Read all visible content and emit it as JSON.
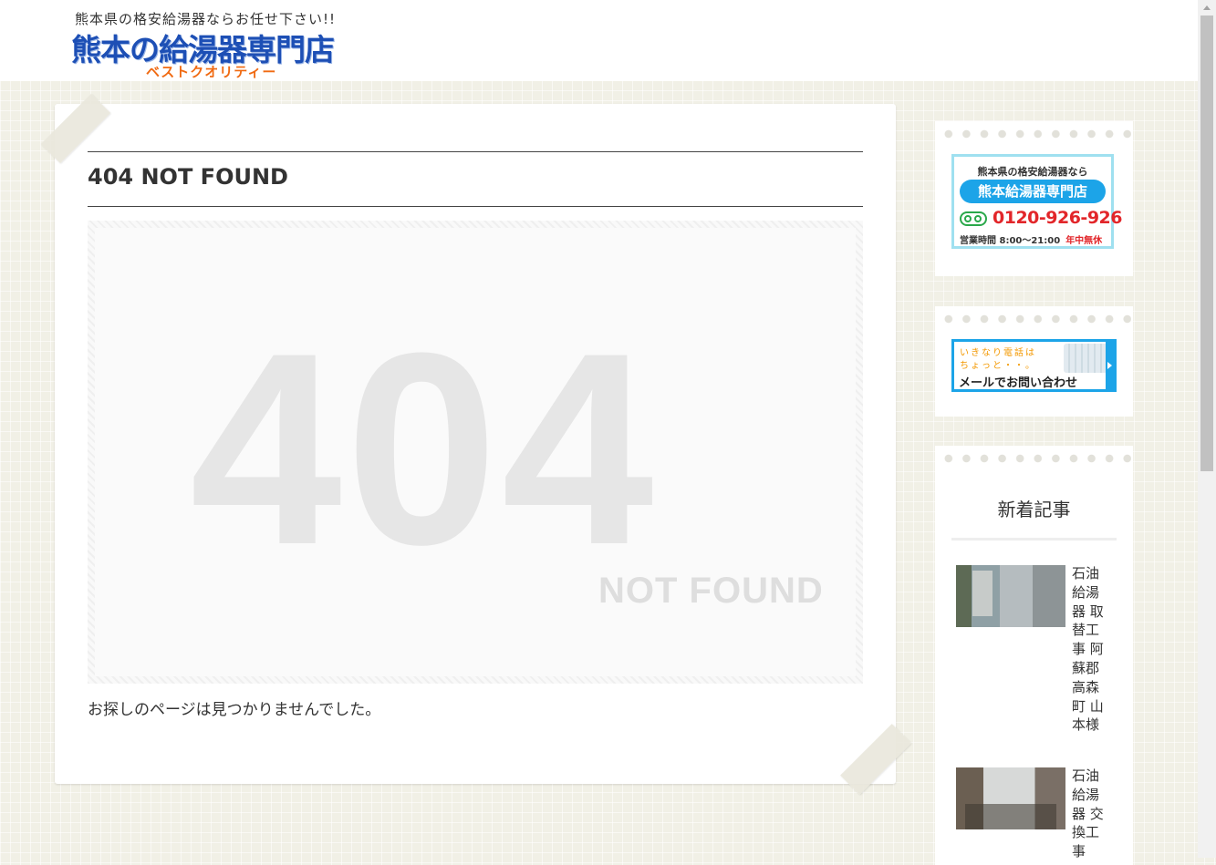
{
  "header": {
    "tagline": "熊本県の格安給湯器ならお任せ下さい!!",
    "site_name": "熊本の給湯器専門店",
    "site_sub": "ベストクオリティー"
  },
  "main": {
    "title": "404 NOT FOUND",
    "image_big": "404",
    "image_small": "NOT FOUND",
    "message": "お探しのページは見つかりませんでした。"
  },
  "sidebar": {
    "tel_banner": {
      "line1": "熊本県の格安給湯器なら",
      "shop": "熊本給湯器専門店",
      "phone": "0120-926-926",
      "hours": "営業時間 8:00〜21:00",
      "open_days": "年中無休"
    },
    "mail_banner": {
      "handwritten_1": "いきなり電話は",
      "handwritten_2": "ちょっと・・。",
      "text": "メールでお問い合わせ"
    },
    "recent": {
      "title": "新着記事",
      "posts": [
        {
          "title": "石油給湯器 取替工事 阿蘇郡高森町 山本様"
        },
        {
          "title": "石油給湯器 交換工事"
        }
      ]
    }
  },
  "colors": {
    "accent_blue": "#1ca4e8",
    "logo_blue": "#1d4fb5",
    "logo_orange": "#f06a12",
    "phone_red": "#e2262a",
    "freedial_green": "#2aa84a"
  }
}
